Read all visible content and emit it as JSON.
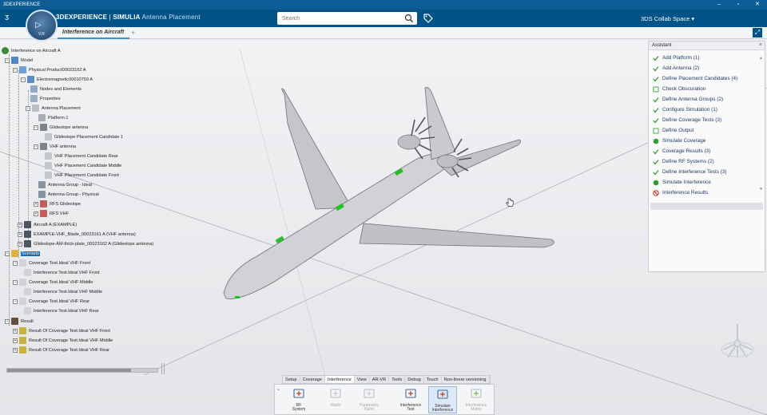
{
  "window": {
    "title": "3DEXPERIENCE"
  },
  "topbar": {
    "brand_bold": "3DEXPERIENCE",
    "brand_sep": " | ",
    "brand_simulia": "SIMULIA",
    "brand_app": " Antenna Placement",
    "search_placeholder": "Search",
    "collab_space": "3DS Collab Space",
    "compass_label": "V,R"
  },
  "tabs": {
    "active": "Interference on Aircraft",
    "add": "+"
  },
  "tree": {
    "root": "Interference on Aircraft A",
    "model": "Model",
    "physical_product": "Physical Product00023162 A",
    "electromagnetic": "Electromagnetic00010759 A",
    "nodes_elements": "Nodes and Elements",
    "properties": "Properties",
    "antenna_placement": "Antenna Placement",
    "platform": "Platform.1",
    "glideslope_antenna": "Glideslope antenna",
    "glideslope_candidate": "Glideslope Placement Candidate 1",
    "vhf_antenna": "VHF antenna",
    "vhf_rear": "VHF Placement Candidate Rear",
    "vhf_middle": "VHF Placement Candidate Middle",
    "vhf_front": "VHF Placement Candidate Front",
    "group_ideal": "Antenna Group - Ideal",
    "group_physical": "Antenna Group - Physical",
    "rfs_glideslope": "RFS Glideslope",
    "rfs_vhf": "RFS VHF",
    "aircraft": "Aircraft A (EXAMPLE)",
    "example_vhf_blade": "EXAMPLE-VHF_Blade_00023161 A (VHF antenna)",
    "glideslope_plate": "Glideslope-AM-thick-plate_00023162 A (Glideslope antenna)",
    "scenario": "Scenario",
    "cov_front": "Coverage Test.Ideal VHF Front",
    "int_front": "Interference Test.Ideal VHF Front",
    "cov_middle": "Coverage Test.Ideal VHF Middle",
    "int_middle": "Interference Test.Ideal VHF Middle",
    "cov_rear": "Coverage Test.Ideal VHF Rear",
    "int_rear": "Interference Test.Ideal VHF Rear",
    "result": "Result",
    "res_front": "Result Of Coverage Test.Ideal VHF Front",
    "res_middle": "Result Of Coverage Test.Ideal VHF Middle",
    "res_rear": "Result Of Coverage Test.Ideal VHF Rear"
  },
  "assistant": {
    "title": "Assistant",
    "close": "×",
    "steps": [
      {
        "label": "Add Platform (1)",
        "status": "done"
      },
      {
        "label": "Add Antenna (2)",
        "status": "done"
      },
      {
        "label": "Define Placement Candidates (4)",
        "status": "done"
      },
      {
        "label": "Check Obscuration",
        "status": "todo"
      },
      {
        "label": "Define Antenna Groups (2)",
        "status": "done"
      },
      {
        "label": "Configure Simulation (1)",
        "status": "done"
      },
      {
        "label": "Define Coverage Tests (3)",
        "status": "done"
      },
      {
        "label": "Define Output",
        "status": "todo"
      },
      {
        "label": "Simulate Coverage",
        "status": "run"
      },
      {
        "label": "Coverage Results (3)",
        "status": "done"
      },
      {
        "label": "Define RF Systems (2)",
        "status": "done"
      },
      {
        "label": "Define Interference Tests (3)",
        "status": "done"
      },
      {
        "label": "Simulate Interference",
        "status": "run"
      },
      {
        "label": "Interference Results",
        "status": "blocked"
      }
    ]
  },
  "actionbar": {
    "tabs": [
      "Setup",
      "Coverage",
      "Interference",
      "View",
      "AR-VR",
      "Tools",
      "Debug",
      "Touch",
      "Non-linear versioning"
    ],
    "active_tab": "Interference",
    "tools": [
      {
        "l1": "RF",
        "l2": "System",
        "state": "normal"
      },
      {
        "l1": "Radio",
        "l2": "",
        "state": "disabled"
      },
      {
        "l1": "Parametric",
        "l2": "Band",
        "state": "disabled"
      },
      {
        "l1": "Interference",
        "l2": "Test",
        "state": "normal"
      },
      {
        "l1": "Simulate",
        "l2": "Interference",
        "state": "active"
      },
      {
        "l1": "Interference",
        "l2": "Matrix",
        "state": "disabled"
      }
    ]
  },
  "colors": {
    "brand_blue": "#005386",
    "done_green": "#3aa53a",
    "run_green": "#2e9e2e",
    "blocked_red": "#d9342b",
    "antenna_green": "#22c02a"
  },
  "icons": {
    "search": "search-icon",
    "tag": "tag-icon",
    "user": "user-icon",
    "add": "plus-icon",
    "share": "share-icon",
    "help": "help-icon"
  }
}
